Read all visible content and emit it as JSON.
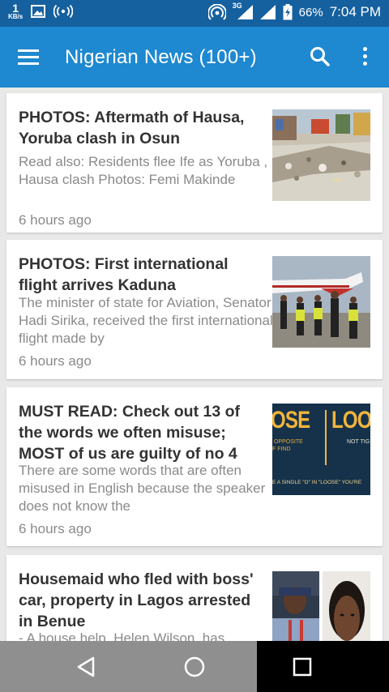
{
  "status_bar": {
    "speed_value": "1",
    "speed_unit": "KB/s",
    "network": "3G",
    "battery": "66%",
    "time": "7:04 PM"
  },
  "app_bar": {
    "title": "Nigerian News (100+)",
    "menu_icon": "hamburger-menu-icon",
    "search_icon": "search-icon",
    "more_icon": "more-vertical-icon"
  },
  "articles": [
    {
      "headline": "PHOTOS: Aftermath of Hausa, Yoruba clash in Osun",
      "summary": "Read also:  Residents flee Ife as Yoruba , Hausa clash  Photos: Femi Makinde",
      "time": "6 hours ago"
    },
    {
      "headline": "PHOTOS: First international flight arrives Kaduna",
      "summary": "The minister of state for Aviation, Senator Hadi Sirika, received the first international flight made by",
      "time": "6 hours ago"
    },
    {
      "headline": "MUST READ: Check out 13 of the words we often misuse; MOST of us are guilty of no 4",
      "summary": "There are some words that are often misused in English because the speaker does not know the",
      "time": "6 hours ago",
      "thumb_text": {
        "word_left": "OSE",
        "word_right": "LOO",
        "sub_left_1": "OPPOSITE",
        "sub_left_2": "F FIND",
        "sub_right": "NOT TIG",
        "bottom": "E A SINGLE \"O\" IN \"LOOSE\" YOU'RE"
      }
    },
    {
      "headline": "Housemaid who fled with boss' car, property in Lagos arrested in Benue",
      "summary": "- A house help, Helen Wilson, has"
    }
  ],
  "nav_bar": {
    "back_icon": "back-triangle-icon",
    "home_icon": "home-circle-icon",
    "recents_icon": "recents-square-icon"
  },
  "colors": {
    "status_bar": "#15609f",
    "app_bar": "#1e88d0",
    "background": "#e8e8e8",
    "headline": "#333333",
    "summary": "#8a8a8a"
  }
}
